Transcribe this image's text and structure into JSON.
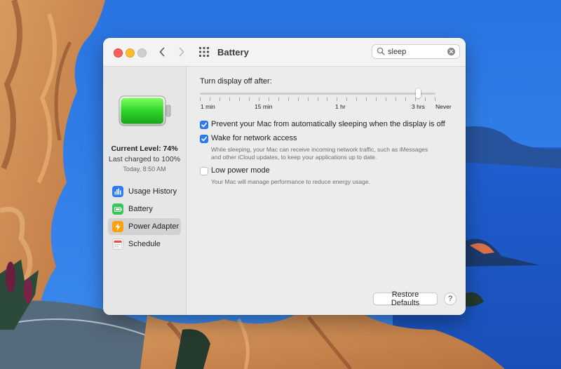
{
  "window": {
    "title": "Battery"
  },
  "search": {
    "value": "sleep"
  },
  "sidebar": {
    "current_level": "Current Level: 74%",
    "charged_status": "Last charged to 100%",
    "timestamp": "Today, 8:50 AM",
    "battery_level": 0.74,
    "items": [
      {
        "label": "Usage History",
        "icon": "bar-chart-icon",
        "color": "#2d7cf6"
      },
      {
        "label": "Battery",
        "icon": "battery-icon",
        "color": "#34c759"
      },
      {
        "label": "Power Adapter",
        "icon": "lightning-icon",
        "color": "#ff9f0a",
        "selected": true
      },
      {
        "label": "Schedule",
        "icon": "calendar-icon",
        "color": "#ffffff"
      }
    ]
  },
  "main": {
    "slider": {
      "title": "Turn display off after:",
      "labels": [
        "1 min",
        "15 min",
        "1 hr",
        "3 hrs",
        "Never"
      ],
      "value": "3 hrs"
    },
    "options": [
      {
        "label": "Prevent your Mac from automatically sleeping when the display is off",
        "checked": true,
        "description": []
      },
      {
        "label": "Wake for network access",
        "checked": true,
        "description": [
          "While sleeping, your Mac can receive incoming network traffic, such as iMessages",
          "and other iCloud updates, to keep your applications up to date."
        ]
      },
      {
        "label": "Low power mode",
        "checked": false,
        "description": [
          "Your Mac will manage performance to reduce energy usage."
        ]
      }
    ],
    "restore_defaults_label": "Restore Defaults",
    "help_label": "?"
  },
  "colors": {
    "accent": "#2d7cf6",
    "battery_green": "#34c759"
  }
}
